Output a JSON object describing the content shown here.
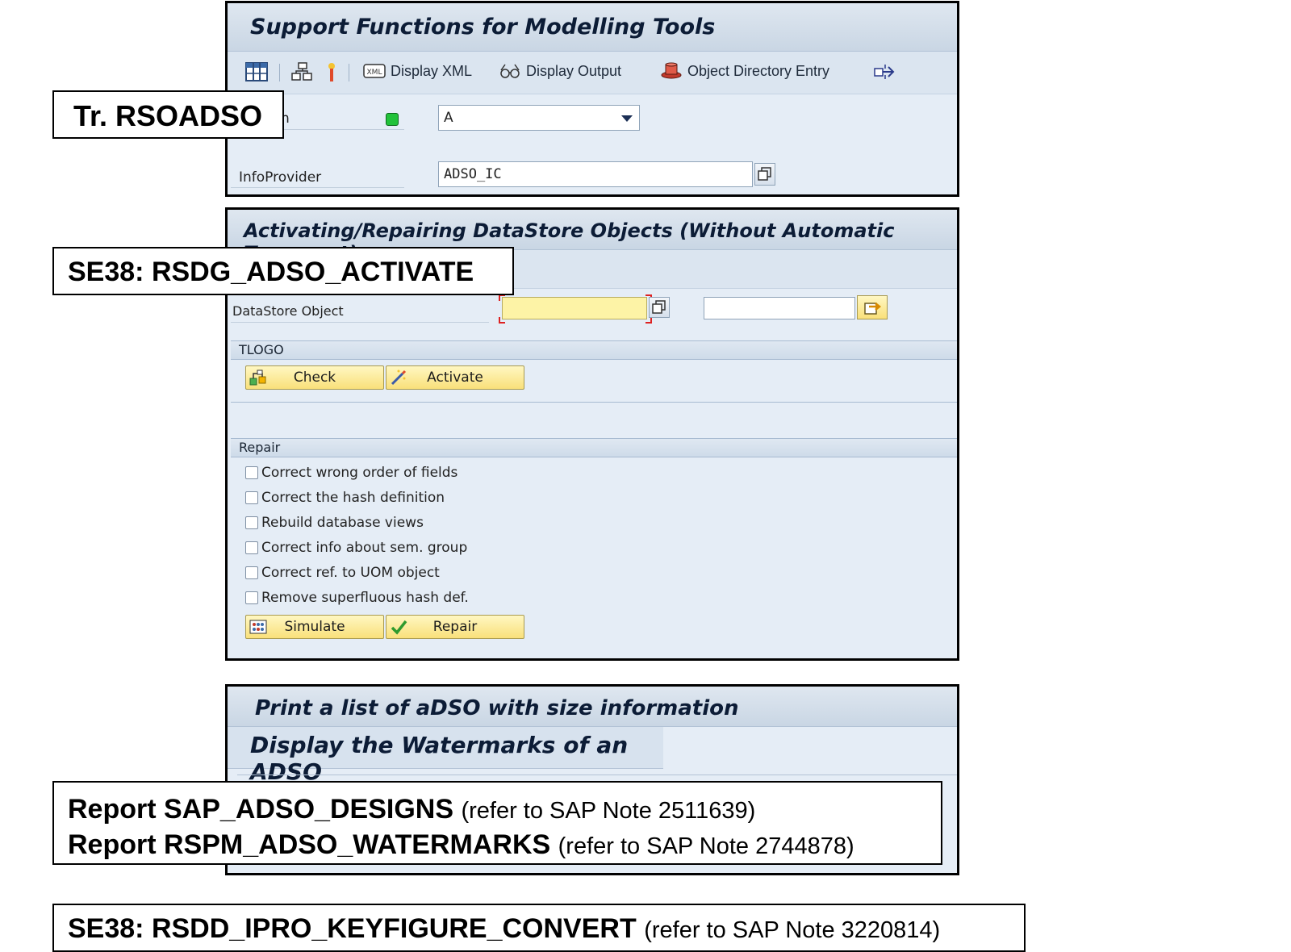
{
  "panel1": {
    "title": "Support Functions for Modelling Tools",
    "toolbar": {
      "display_xml": "Display XML",
      "display_output": "Display Output",
      "object_directory_entry": "Object Directory Entry"
    },
    "version_label_fragment": "n",
    "version_value": "A",
    "infoprovider_label": "InfoProvider",
    "infoprovider_value": "ADSO_IC"
  },
  "panel2": {
    "title": "Activating/Repairing DataStore Objects (Without Automatic Transport)",
    "datastore_label": "DataStore Object",
    "datastore_value": "",
    "datastore_to_value": "",
    "tlogo_label": "TLOGO",
    "check_button": "Check",
    "activate_button": "Activate",
    "repair_label": "Repair",
    "options": [
      {
        "label": "Correct wrong order of fields",
        "checked": false
      },
      {
        "label": "Correct the hash definition",
        "checked": false
      },
      {
        "label": "Rebuild database views",
        "checked": false
      },
      {
        "label": "Correct info about sem. group",
        "checked": false
      },
      {
        "label": "Correct ref. to UOM object",
        "checked": false
      },
      {
        "label": "Remove superfluous hash def.",
        "checked": false
      }
    ],
    "simulate_button": "Simulate",
    "repair_button": "Repair"
  },
  "panel3": {
    "title1": "Print a list of aDSO with size information",
    "title2": "Display the Watermarks of an ADSO"
  },
  "callouts": {
    "rsoadso": "Tr. RSOADSO",
    "se38_activate": "SE38: RSDG_ADSO_ACTIVATE",
    "report1_bold": "Report SAP_ADSO_DESIGNS",
    "report1_note": "(refer to SAP Note 2511639)",
    "report2_bold": "Report RSPM_ADSO_WATERMARKS",
    "report2_note": "(refer to SAP Note 2744878)",
    "se38_convert_bold": "SE38: RSDD_IPRO_KEYFIGURE_CONVERT",
    "se38_convert_note": "(refer to SAP Note 3220814)"
  },
  "colors": {
    "panel_bg": "#e5edf6",
    "title_text": "#0c1c36",
    "button_yellow": "#f9e07a",
    "required_field": "#fdf3a6",
    "status_green": "#22c23a"
  }
}
